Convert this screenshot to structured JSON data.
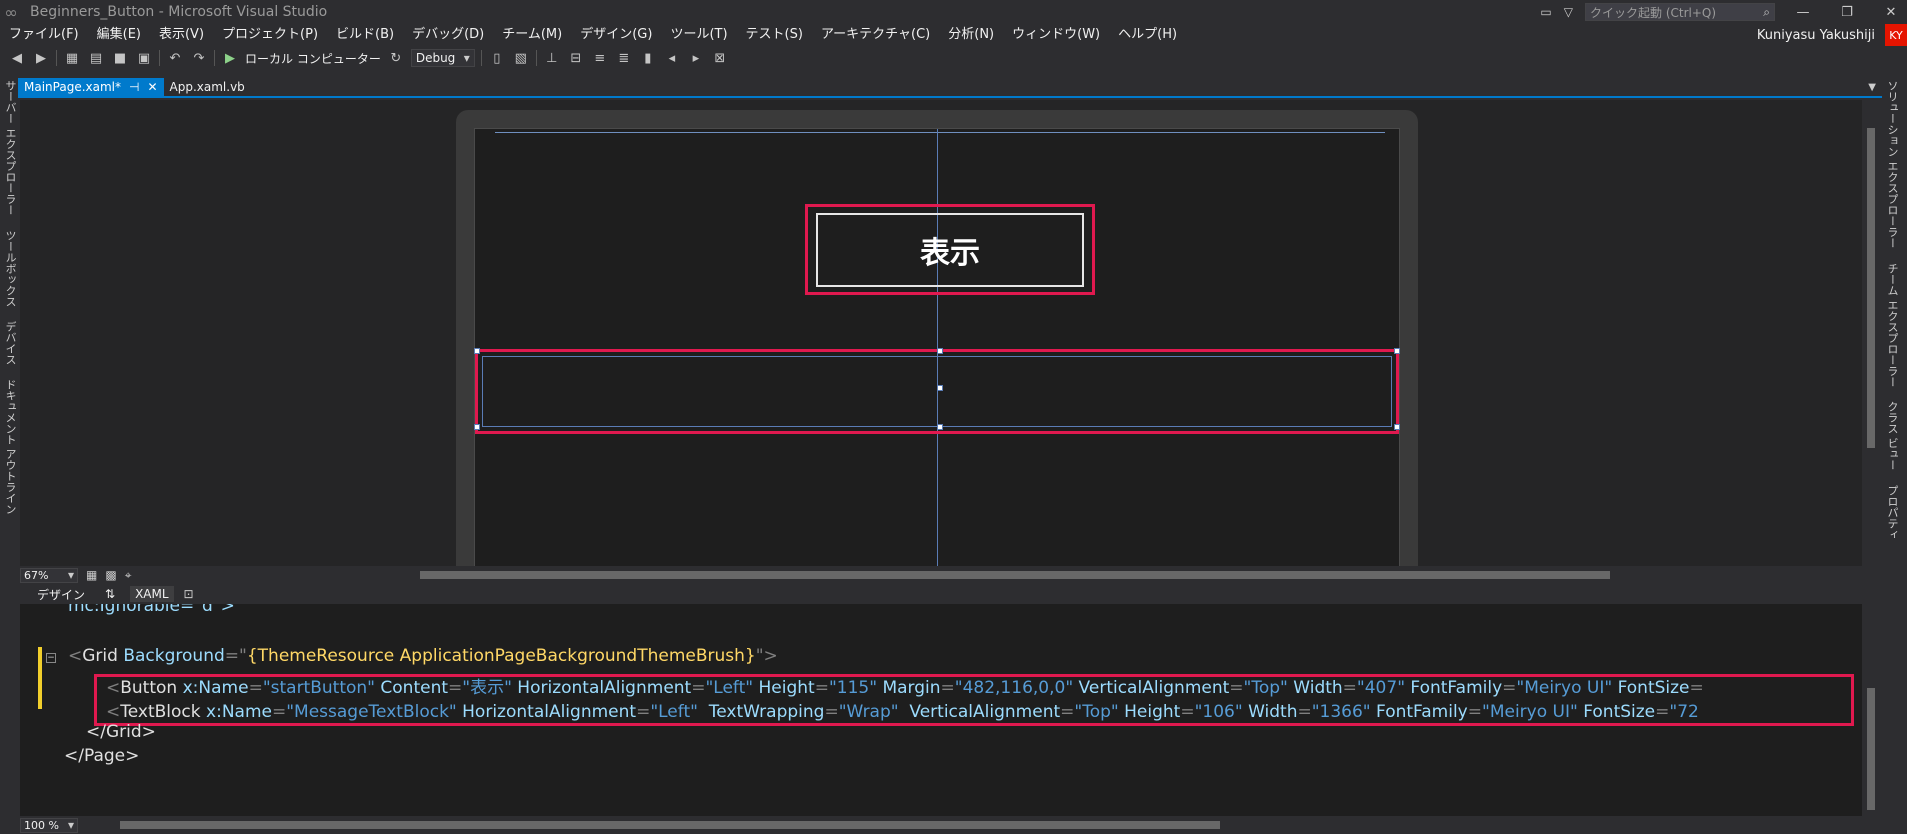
{
  "window": {
    "title": "Beginners_Button - Microsoft Visual Studio",
    "quick_launch_placeholder": "クイック起動 (Ctrl+Q)"
  },
  "menu": [
    "ファイル(F)",
    "編集(E)",
    "表示(V)",
    "プロジェクト(P)",
    "ビルド(B)",
    "デバッグ(D)",
    "チーム(M)",
    "デザイン(G)",
    "ツール(T)",
    "テスト(S)",
    "アーキテクチャ(C)",
    "分析(N)",
    "ウィンドウ(W)",
    "ヘルプ(H)"
  ],
  "user": {
    "name": "Kuniyasu Yakushiji",
    "initials": "KY"
  },
  "toolbar": {
    "run_target": "ローカル コンピューター",
    "config": "Debug"
  },
  "left_panels": [
    "サーバー エクスプローラー",
    "ツールボックス",
    "デバイス",
    "ドキュメント アウトライン"
  ],
  "right_panels": [
    "ソリューション エクスプローラー",
    "チーム エクスプローラー",
    "クラス ビュー",
    "プロパティ"
  ],
  "tabs": [
    {
      "label": "MainPage.xaml*",
      "pin": "⊣",
      "close": "✕"
    },
    {
      "label": "App.xaml.vb"
    }
  ],
  "designer": {
    "button_content": "表示",
    "zoom": "67%"
  },
  "split": {
    "design_tab": "デザイン",
    "swap": "⇅",
    "xaml_tab": "XAML"
  },
  "code": {
    "line0": {
      "text": "mc:Ignorable=\"d\">"
    },
    "line2": {
      "open": "<",
      "el": "Grid",
      "attr": " Background",
      "eq": "=\"",
      "res": "{ThemeResource ApplicationPageBackgroundThemeBrush}",
      "close": "\">"
    },
    "line3": {
      "el": "Button",
      "a1": " x:Name",
      "v1": "\"startButton\"",
      "a2": " Content",
      "v2": "\"表示\"",
      "a3": " HorizontalAlignment",
      "v3": "\"Left\"",
      "a4": " Height",
      "v4": "\"115\"",
      "a5": " Margin",
      "v5": "\"482,116,0,0\"",
      "a6": " VerticalAlignment",
      "v6": "\"Top\"",
      "a7": " Width",
      "v7": "\"407\"",
      "a8": " FontFamily",
      "v8": "\"Meiryo UI\"",
      "a9": " FontSize",
      "v9": "="
    },
    "line4": {
      "el": "TextBlock",
      "a1": " x:Name",
      "v1": "\"MessageTextBlock\"",
      "a2": " HorizontalAlignment",
      "v2": "\"Left\"",
      "a3": "  TextWrapping",
      "v3": "\"Wrap\"",
      "a4": "  VerticalAlignment",
      "v4": "\"Top\"",
      "a5": " Height",
      "v5": "\"106\"",
      "a6": " Width",
      "v6": "\"1366\"",
      "a7": " FontFamily",
      "v7": "\"Meiryo UI\"",
      "a8": " FontSize",
      "v8": "\"72"
    },
    "line5": {
      "text": "</Grid>"
    },
    "line6": {
      "text": "</Page>"
    }
  },
  "editor_zoom": "100 %"
}
